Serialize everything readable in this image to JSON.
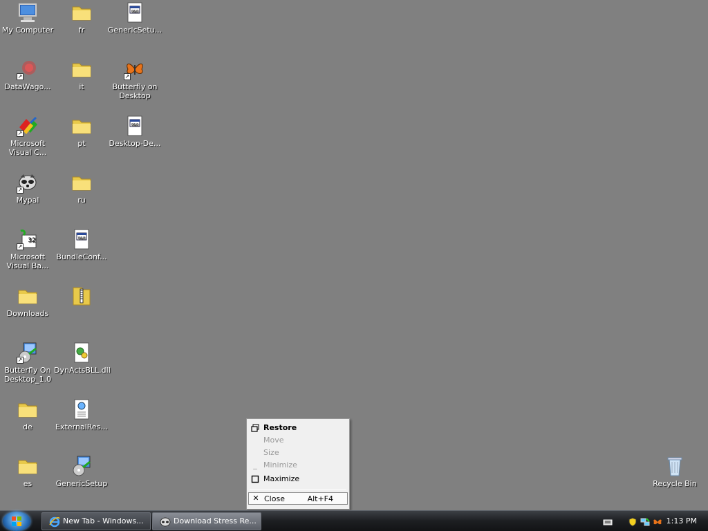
{
  "desktop": {
    "icons": [
      {
        "label": "My Computer",
        "icon": "computer-icon"
      },
      {
        "label": "fr",
        "icon": "folder-icon"
      },
      {
        "label": "GenericSetu...",
        "icon": "document-icon"
      },
      {
        "label": "DataWago...",
        "icon": "datawagon-icon"
      },
      {
        "label": "it",
        "icon": "folder-icon"
      },
      {
        "label": "Butterfly on Desktop",
        "icon": "butterfly-icon"
      },
      {
        "label": "Microsoft Visual C...",
        "icon": "visual-studio-icon"
      },
      {
        "label": "pt",
        "icon": "folder-icon"
      },
      {
        "label": "Desktop-De...",
        "icon": "document-icon"
      },
      {
        "label": "Mypal",
        "icon": "mypal-icon"
      },
      {
        "label": "ru",
        "icon": "folder-icon"
      },
      {
        "label": "Microsoft Visual Ba...",
        "icon": "visual-basic-icon"
      },
      {
        "label": "BundleConf...",
        "icon": "document-icon"
      },
      {
        "label": "Downloads",
        "icon": "folder-icon"
      },
      {
        "label": "",
        "icon": "zip-folder-icon"
      },
      {
        "label": "Butterfly On Desktop_1.0",
        "icon": "installer-icon"
      },
      {
        "label": "DynActsBLL.dll",
        "icon": "dll-icon"
      },
      {
        "label": "de",
        "icon": "folder-icon"
      },
      {
        "label": "ExternalRes...",
        "icon": "web-document-icon"
      },
      {
        "label": "es",
        "icon": "folder-icon"
      },
      {
        "label": "GenericSetup",
        "icon": "installer-icon"
      },
      {
        "label": "Recycle Bin",
        "icon": "recycle-bin-icon"
      }
    ]
  },
  "context_menu": {
    "restore": "Restore",
    "move": "Move",
    "size": "Size",
    "minimize": "Minimize",
    "maximize": "Maximize",
    "close": "Close",
    "close_accel": "Alt+F4"
  },
  "taskbar": {
    "tasks": [
      {
        "label": "New Tab - Windows...",
        "icon": "ie-icon"
      },
      {
        "label": "Download Stress Re...",
        "icon": "mypal-icon"
      }
    ],
    "clock": "1:13 PM"
  }
}
